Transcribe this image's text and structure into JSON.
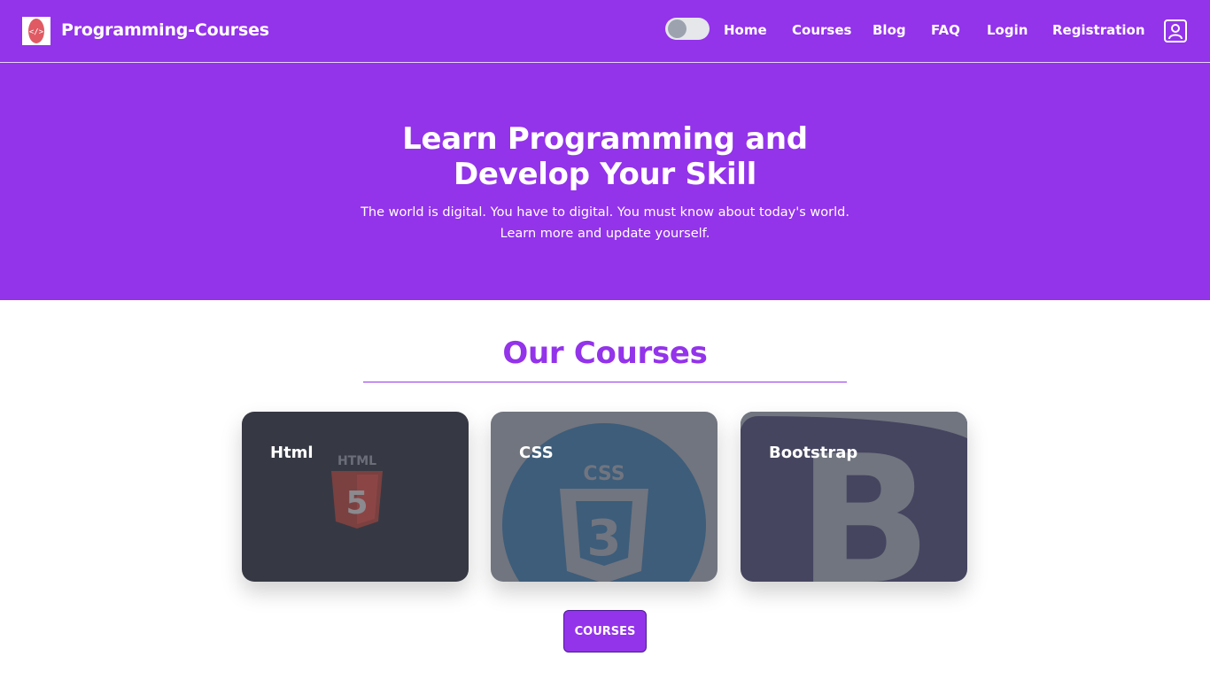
{
  "nav": {
    "brand": "Programming-Courses",
    "links": [
      "Home",
      "Courses",
      "Blog",
      "FAQ",
      "Login",
      "Registration"
    ],
    "theme_toggle_on": false
  },
  "hero": {
    "title_line1": "Learn Programming and",
    "title_line2": "Develop Your Skill",
    "subtitle_line1": "The world is digital. You have to digital. You must know about today's world.",
    "subtitle_line2": "Learn more and update yourself."
  },
  "courses": {
    "heading": "Our Courses",
    "cards": [
      {
        "label": "Html",
        "icon": "html5-logo-icon"
      },
      {
        "label": "CSS",
        "icon": "css3-logo-icon"
      },
      {
        "label": "Bootstrap",
        "icon": "bootstrap-logo-icon"
      }
    ],
    "button_label": "COURSES"
  },
  "colors": {
    "primary": "#9333ea",
    "white": "#ffffff"
  }
}
